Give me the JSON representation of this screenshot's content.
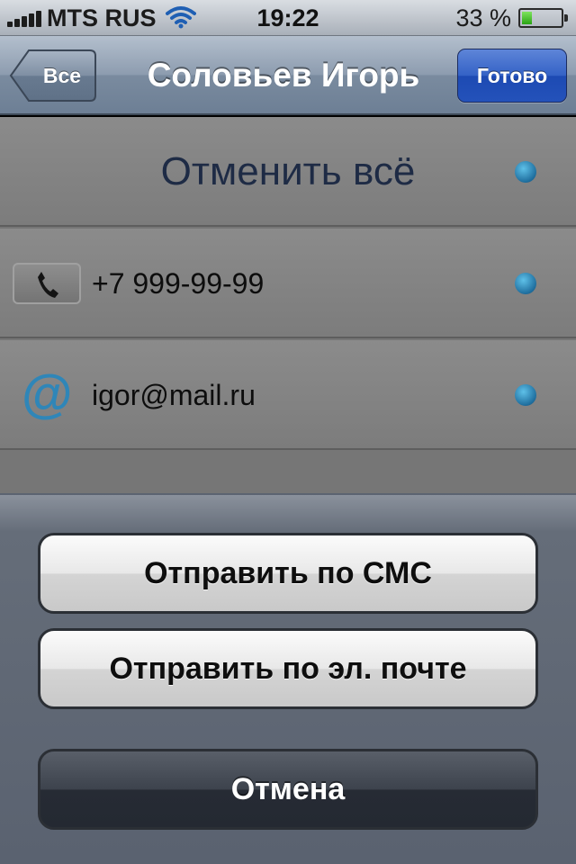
{
  "status_bar": {
    "carrier": "MTS RUS",
    "time": "19:22",
    "battery_percent": "33 %",
    "battery_level": 0.33,
    "icons": [
      "signal-bars-icon",
      "wifi-icon",
      "battery-icon"
    ]
  },
  "nav_bar": {
    "back_label": "Все",
    "title": "Соловьев Игорь",
    "done_label": "Готово"
  },
  "contact": {
    "cancel_all_label": "Отменить всё",
    "phone": "+7 999-99-99",
    "email": "igor@mail.ru",
    "phone_icon": "phone-icon",
    "email_icon": "at-sign-icon"
  },
  "action_sheet": {
    "send_sms_label": "Отправить по СМС",
    "send_email_label": "Отправить по эл. почте",
    "cancel_label": "Отмена"
  },
  "colors": {
    "done_button": "#2452ba",
    "selection_dot": "#1f6e9e",
    "cancel_button": "#262b34"
  }
}
